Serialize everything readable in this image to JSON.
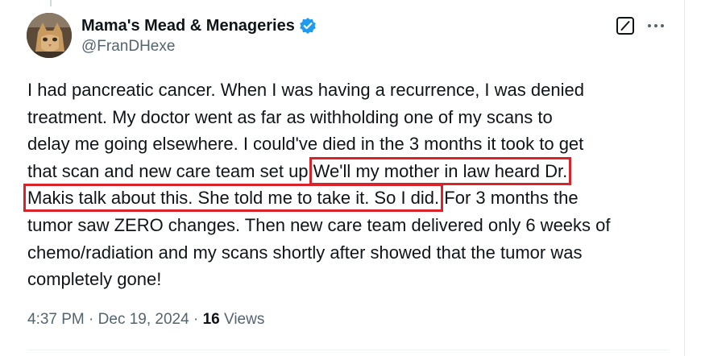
{
  "author": {
    "display_name": "Mama's Mead & Menageries",
    "handle": "@FranDHexe",
    "verified": true,
    "verified_color": "#1d9bf0",
    "avatar_icon": "cat-avatar"
  },
  "actions": {
    "grok_icon": "grok-slash-icon",
    "more_icon": "more-dots-icon"
  },
  "tweet": {
    "lines": [
      "I had pancreatic cancer. When I was having a recurrence, I was denied",
      "treatment. My doctor went as far as withholding one of my scans to",
      "delay me going elsewhere. I could've died in the 3 months it took to get",
      "that scan and new care team set up.",
      "We'll my mother in law heard Dr.",
      "Makis talk about this. She told me to take it. So I did.",
      " For 3 months the",
      "tumor saw ZERO changes. Then new care team delivered only 6 weeks of",
      "chemo/radiation and my scans shortly after showed that the tumor was",
      "completely gone!"
    ],
    "highlight_color": "#d8232a"
  },
  "meta": {
    "time": "4:37 PM",
    "sep1": " · ",
    "date": "Dec 19, 2024",
    "sep2": " · ",
    "views_count": "16",
    "views_label": " Views"
  }
}
